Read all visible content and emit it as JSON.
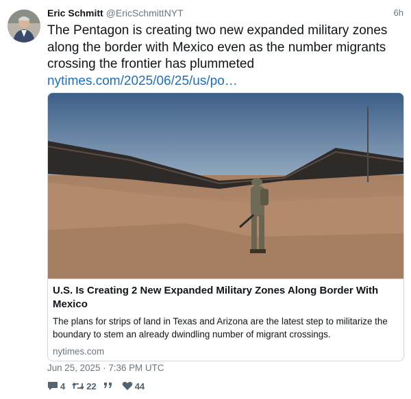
{
  "tweet": {
    "author_name": "Eric Schmitt",
    "author_handle": "@EricSchmittNYT",
    "relative_time": "6h",
    "text": "The Pentagon is creating two new expanded military zones along the border with Mexico even as the number migrants crossing the frontier has plummeted",
    "link_text": "nytimes.com/2025/06/25/us/po…",
    "timestamp": "Jun 25, 2025 · 7:36 PM UTC"
  },
  "card": {
    "title": "U.S. Is Creating 2 New Expanded Military Zones Along Border With Mexico",
    "description": "The plans for strips of land in Texas and Arizona are the latest step to militarize the boundary to stem an already dwindling number of migrant crossings.",
    "domain": "nytimes.com"
  },
  "actions": {
    "replies": "4",
    "retweets": "22",
    "quotes": "",
    "likes": "44",
    "icons": [
      "comment-icon",
      "retweet-icon",
      "quote-icon",
      "heart-icon"
    ]
  },
  "colors": {
    "link": "#1d6fbf",
    "secondary_text": "#687684",
    "border": "#cfd9de"
  }
}
